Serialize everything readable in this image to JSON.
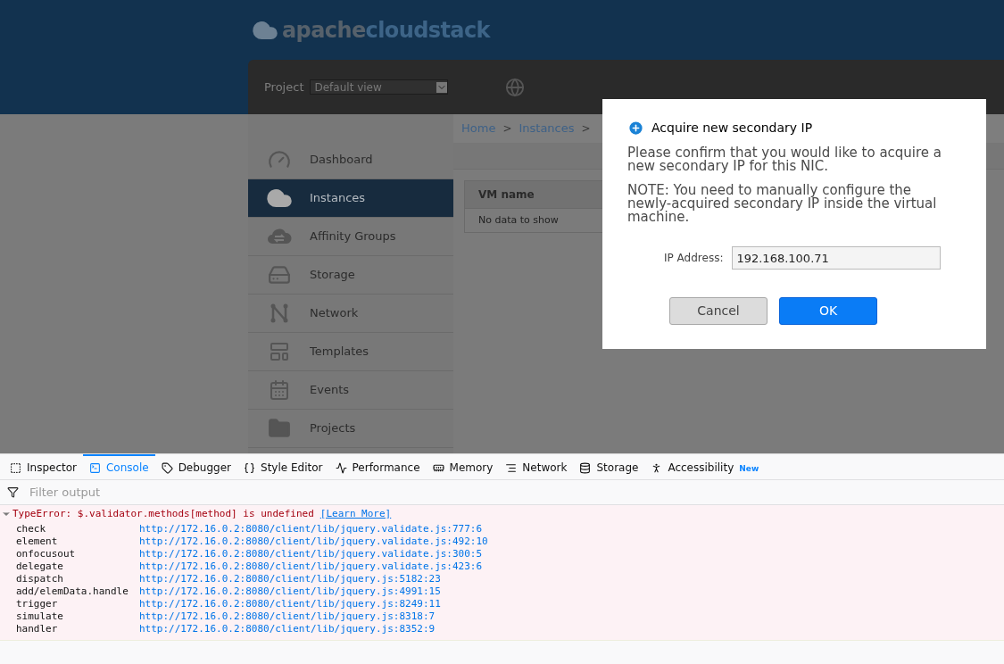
{
  "header": {
    "logo": {
      "part_1": "apache",
      "part_2": "cloudstack"
    },
    "project_label": "Project",
    "project_select": "Default view"
  },
  "breadcrumb": [
    {
      "kind": "link",
      "text": "Home"
    },
    {
      "kind": "separator",
      "text": ">"
    },
    {
      "kind": "link",
      "text": "Instances"
    },
    {
      "kind": "separator",
      "text": ">"
    }
  ],
  "sidebar": {
    "items": [
      {
        "label": "Dashboard",
        "selected": false
      },
      {
        "label": "Instances",
        "selected": true
      },
      {
        "label": "Affinity Groups",
        "selected": false
      },
      {
        "label": "Storage",
        "selected": false
      },
      {
        "label": "Network",
        "selected": false
      },
      {
        "label": "Templates",
        "selected": false
      },
      {
        "label": "Events",
        "selected": false
      },
      {
        "label": "Projects",
        "selected": false
      }
    ]
  },
  "table": {
    "columns": [
      "VM name"
    ],
    "empty_text": "No data to show"
  },
  "dialog": {
    "title": "Acquire new secondary IP",
    "paragraphs": [
      "Please confirm that you would like to acquire a new secondary IP for this NIC.",
      "NOTE: You need to manually configure the newly-acquired secondary IP inside the virtual machine."
    ],
    "field": {
      "label": "IP Address:",
      "value": "192.168.100.71"
    },
    "buttons": [
      {
        "label": "Cancel",
        "kind": "secondary"
      },
      {
        "label": "OK",
        "kind": "primary"
      }
    ]
  },
  "devtools": {
    "tabs": [
      {
        "label": "Inspector",
        "selected": false
      },
      {
        "label": "Console",
        "selected": true
      },
      {
        "label": "Debugger",
        "selected": false
      },
      {
        "label": "Style Editor",
        "selected": false
      },
      {
        "label": "Performance",
        "selected": false
      },
      {
        "label": "Memory",
        "selected": false
      },
      {
        "label": "Network",
        "selected": false
      },
      {
        "label": "Storage",
        "selected": false
      },
      {
        "label": "Accessibility",
        "selected": false,
        "badge": "New"
      }
    ],
    "filter": {
      "placeholder": "Filter output"
    },
    "error": {
      "message": "TypeError: $.validator.methods[method] is undefined",
      "link": "[Learn More]",
      "expanded": true,
      "stack": [
        {
          "function": "check",
          "location": "http://172.16.0.2:8080/client/lib/jquery.validate.js:777:6"
        },
        {
          "function": "element",
          "location": "http://172.16.0.2:8080/client/lib/jquery.validate.js:492:10"
        },
        {
          "function": "onfocusout",
          "location": "http://172.16.0.2:8080/client/lib/jquery.validate.js:300:5"
        },
        {
          "function": "delegate",
          "location": "http://172.16.0.2:8080/client/lib/jquery.validate.js:423:6"
        },
        {
          "function": "dispatch",
          "location": "http://172.16.0.2:8080/client/lib/jquery.js:5182:23"
        },
        {
          "function": "add/elemData.handle",
          "location": "http://172.16.0.2:8080/client/lib/jquery.js:4991:15"
        },
        {
          "function": "trigger",
          "location": "http://172.16.0.2:8080/client/lib/jquery.js:8249:11"
        },
        {
          "function": "simulate",
          "location": "http://172.16.0.2:8080/client/lib/jquery.js:8318:7"
        },
        {
          "function": "handler",
          "location": "http://172.16.0.2:8080/client/lib/jquery.js:8352:9"
        }
      ]
    }
  }
}
